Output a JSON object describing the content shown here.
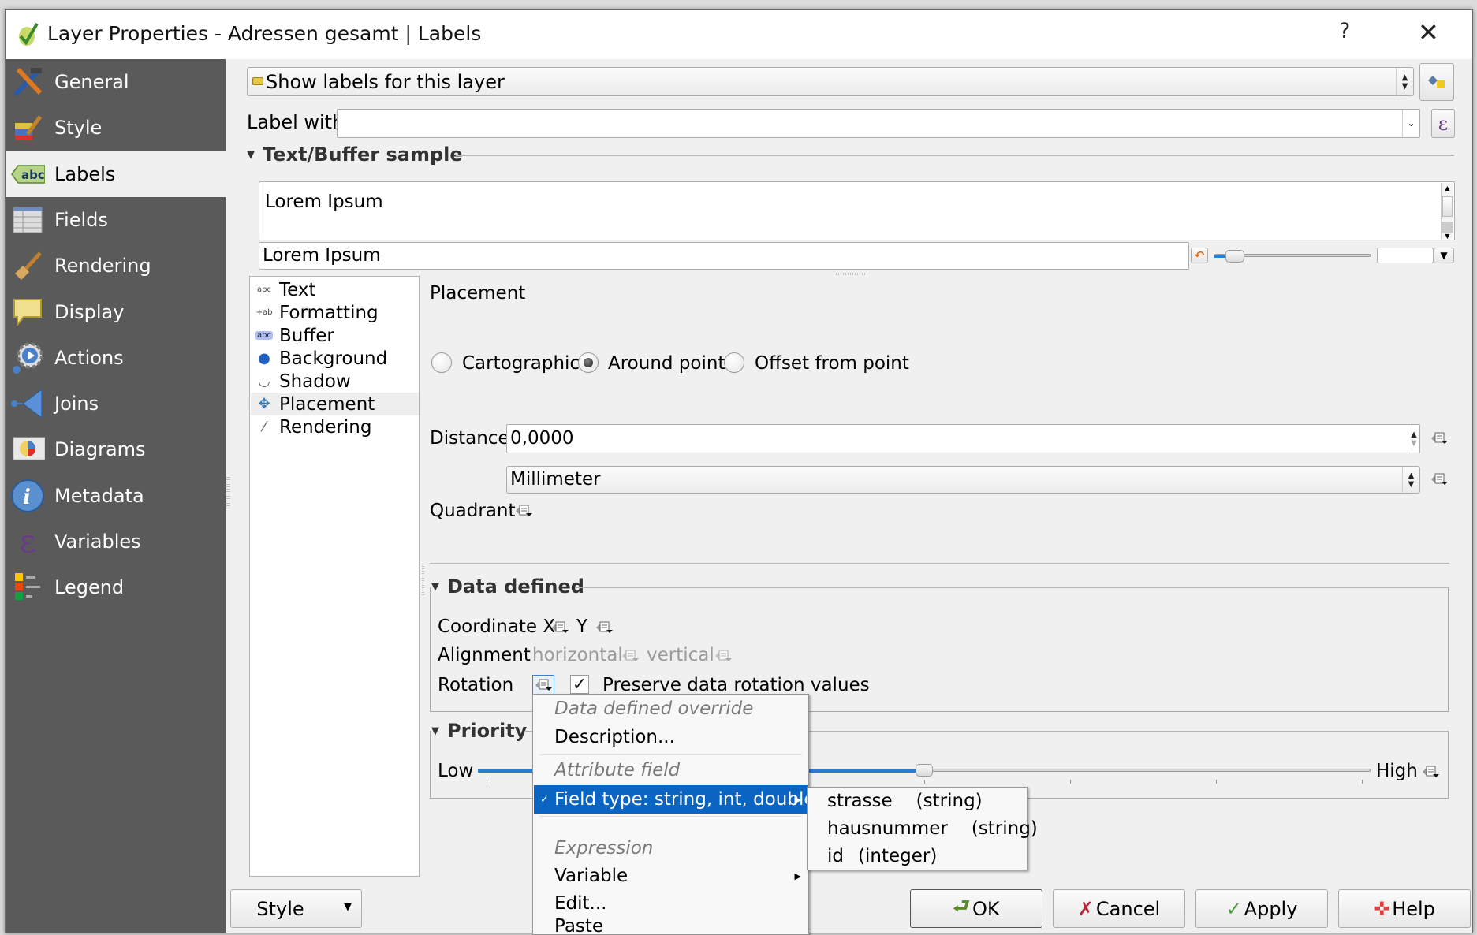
{
  "window": {
    "title": "Layer Properties - Adressen gesamt | Labels",
    "help_label": "?",
    "close_label": "✕"
  },
  "sidebar": {
    "items": [
      {
        "label": "General",
        "icon": "hammer-screwdriver-icon",
        "active": false
      },
      {
        "label": "Style",
        "icon": "paintbrush-icon",
        "active": false
      },
      {
        "label": "Labels",
        "icon": "abc-label-icon",
        "active": true
      },
      {
        "label": "Fields",
        "icon": "table-icon",
        "active": false
      },
      {
        "label": "Rendering",
        "icon": "brush-icon",
        "active": false
      },
      {
        "label": "Display",
        "icon": "speech-bubble-icon",
        "active": false
      },
      {
        "label": "Actions",
        "icon": "gear-play-icon",
        "active": false
      },
      {
        "label": "Joins",
        "icon": "join-arrow-icon",
        "active": false
      },
      {
        "label": "Diagrams",
        "icon": "pie-chart-map-icon",
        "active": false
      },
      {
        "label": "Metadata",
        "icon": "info-icon",
        "active": false
      },
      {
        "label": "Variables",
        "icon": "epsilon-icon",
        "active": false
      },
      {
        "label": "Legend",
        "icon": "legend-icon",
        "active": false
      }
    ]
  },
  "labels": {
    "mode_select": "Show labels for this layer",
    "label_with_label": "Label with",
    "label_with_value": "",
    "text_buffer_sample_title": "Text/Buffer sample",
    "sample_preview_text": "Lorem Ipsum",
    "sample_input_value": "Lorem Ipsum",
    "sample_zoom_fraction": 0.08,
    "tree": [
      {
        "label": "Text",
        "icon_glyph": "abc",
        "selected": false
      },
      {
        "label": "Formatting",
        "icon_glyph": "+ab",
        "selected": false
      },
      {
        "label": "Buffer",
        "icon_glyph": "abc",
        "selected": false
      },
      {
        "label": "Background",
        "icon_glyph": "●",
        "selected": false
      },
      {
        "label": "Shadow",
        "icon_glyph": "◡",
        "selected": false
      },
      {
        "label": "Placement",
        "icon_glyph": "✥",
        "selected": true
      },
      {
        "label": "Rendering",
        "icon_glyph": "⁄",
        "selected": false
      }
    ]
  },
  "placement": {
    "title": "Placement",
    "modes": [
      {
        "label": "Cartographic",
        "checked": false
      },
      {
        "label": "Around point",
        "checked": true
      },
      {
        "label": "Offset from point",
        "checked": false
      }
    ],
    "distance_label": "Distance",
    "distance_value": "0,0000",
    "unit_value": "Millimeter",
    "quadrant_label": "Quadrant"
  },
  "data_defined": {
    "title": "Data defined",
    "coordinate_label": "Coordinate X",
    "y_label": "Y",
    "alignment_label": "Alignment",
    "horizontal_label": "horizontal",
    "vertical_label": "vertical",
    "rotation_label": "Rotation",
    "preserve_rotation_label": "Preserve data rotation values",
    "preserve_rotation_checked": true
  },
  "priority": {
    "title": "Priority",
    "low_label": "Low",
    "high_label": "High",
    "value": 5,
    "min": 0,
    "max": 10
  },
  "context_menu": {
    "items": [
      {
        "label": "Data defined override",
        "type": "header"
      },
      {
        "label": "Description...",
        "type": "item"
      },
      {
        "type": "separator"
      },
      {
        "label": "Attribute field",
        "type": "header"
      },
      {
        "label": "Field type: string, int, double",
        "type": "submenu",
        "highlighted": true,
        "checked": true
      },
      {
        "type": "separator"
      },
      {
        "label": "Expression",
        "type": "header"
      },
      {
        "label": "Variable",
        "type": "submenu"
      },
      {
        "label": "Edit...",
        "type": "item"
      },
      {
        "label": "Paste",
        "type": "item"
      }
    ],
    "submenu": [
      {
        "name": "strasse",
        "type": "(string)"
      },
      {
        "name": "hausnummer",
        "type": "(string)"
      },
      {
        "name": "id",
        "type": "(integer)"
      }
    ]
  },
  "buttons": {
    "style": "Style",
    "ok": "OK",
    "cancel": "Cancel",
    "apply": "Apply",
    "help": "Help"
  },
  "colors": {
    "sidebar_bg": "#5a5a5a",
    "highlight": "#0a64c2",
    "slider_fill": "#2e7bcf"
  }
}
